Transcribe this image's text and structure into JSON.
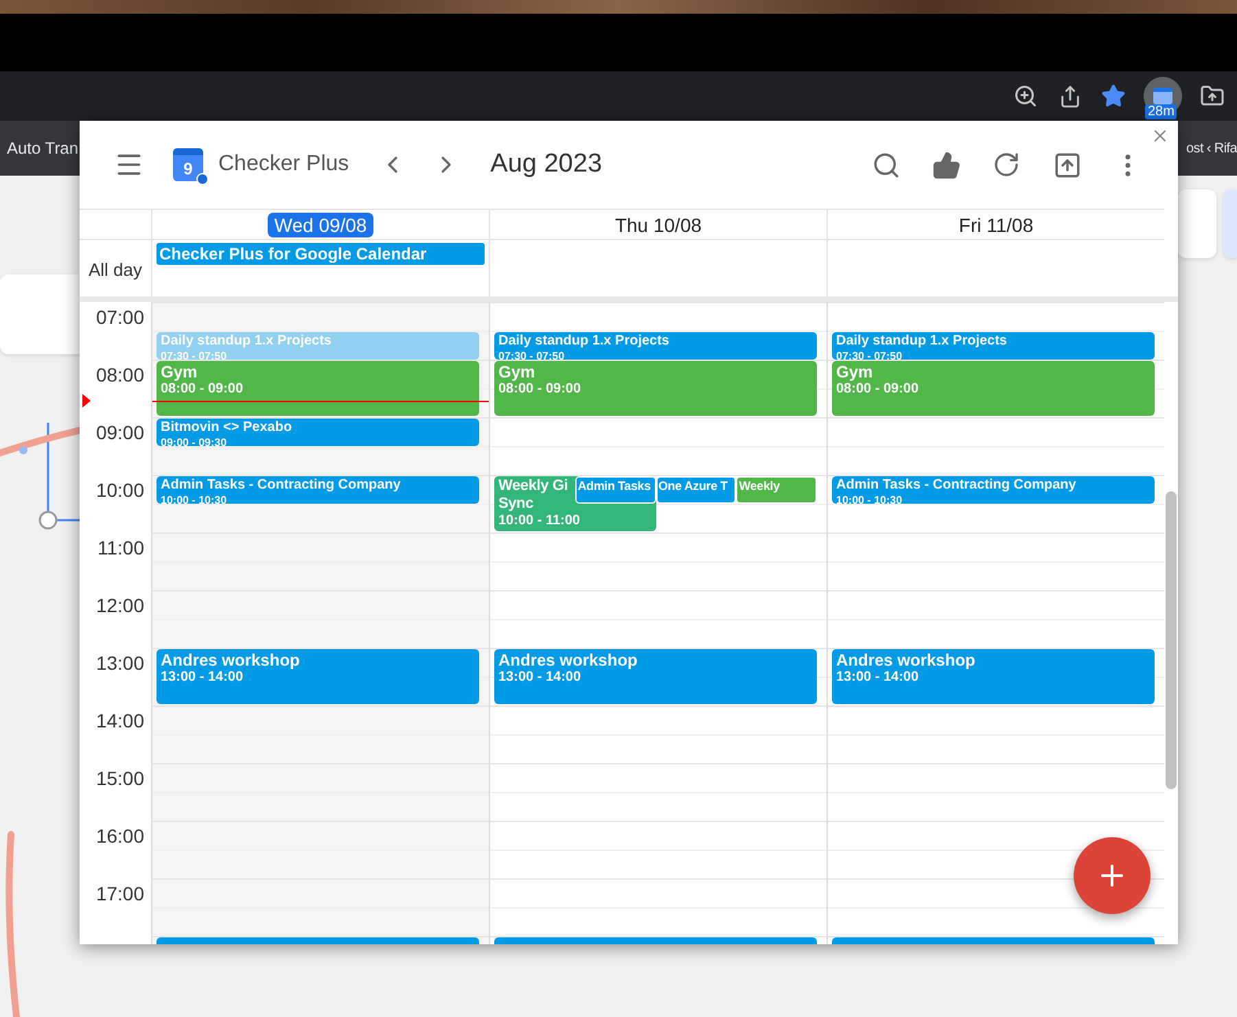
{
  "browser": {
    "extension_badge": "28m",
    "bookmarks": [
      {
        "label": "Auto Tran"
      },
      {
        "label": "ost ‹ Rifa"
      }
    ]
  },
  "popup": {
    "app": {
      "icon_day": "9",
      "name": "Checker Plus"
    },
    "period": "Aug 2023",
    "all_day_label": "All day",
    "hours": [
      "07:00",
      "08:00",
      "09:00",
      "10:00",
      "11:00",
      "12:00",
      "13:00",
      "14:00",
      "15:00",
      "16:00",
      "17:00"
    ],
    "now_marker": {
      "shown": true
    },
    "days": [
      {
        "label": "Wed 09/08",
        "selected": true,
        "all_day": [
          {
            "title": "Checker Plus for Google Calendar",
            "color": "#039be5"
          }
        ],
        "events": [
          {
            "kind": "timed",
            "title": "Daily standup 1.x Projects",
            "time": "07:30 - 07:50",
            "color": "#92d0ef"
          },
          {
            "kind": "timed",
            "title": "Gym",
            "time": "08:00 - 09:00",
            "color": "#51b749"
          },
          {
            "kind": "timed",
            "title": "Bitmovin <> Pexabo",
            "time": "09:00 - 09:30",
            "color": "#039be5"
          },
          {
            "kind": "timed",
            "title": "Admin Tasks - Contracting Company",
            "time": "10:00 - 10:30",
            "color": "#039be5"
          },
          {
            "kind": "timed",
            "title": "Andres workshop",
            "time": "13:00 - 14:00",
            "color": "#039be5"
          },
          {
            "kind": "continued",
            "color": "#039be5"
          }
        ]
      },
      {
        "label": "Thu 10/08",
        "selected": false,
        "events": [
          {
            "kind": "timed",
            "title": "Daily standup 1.x Projects",
            "time": "07:30 - 07:50",
            "color": "#039be5"
          },
          {
            "kind": "timed",
            "title": "Gym",
            "time": "08:00 - 09:00",
            "color": "#51b749"
          },
          {
            "kind": "timed",
            "title": "Weekly Gi\nSync",
            "time": "10:00 - 11:00",
            "color": "#33b679"
          },
          {
            "kind": "overlap",
            "title": "Admin Tasks",
            "color": "#039be5"
          },
          {
            "kind": "overlap",
            "title": "One Azure T",
            "color": "#039be5"
          },
          {
            "kind": "overlap",
            "title": "Weekly",
            "color": "#51b749"
          },
          {
            "kind": "timed",
            "title": "Andres workshop",
            "time": "13:00 - 14:00",
            "color": "#039be5"
          },
          {
            "kind": "continued",
            "color": "#039be5"
          }
        ]
      },
      {
        "label": "Fri 11/08",
        "selected": false,
        "events": [
          {
            "kind": "timed",
            "title": "Daily standup 1.x Projects",
            "time": "07:30 - 07:50",
            "color": "#039be5"
          },
          {
            "kind": "timed",
            "title": "Gym",
            "time": "08:00 - 09:00",
            "color": "#51b749"
          },
          {
            "kind": "timed",
            "title": "Admin Tasks - Contracting Company",
            "time": "10:00 - 10:30",
            "color": "#039be5"
          },
          {
            "kind": "timed",
            "title": "Andres workshop",
            "time": "13:00 - 14:00",
            "color": "#039be5"
          },
          {
            "kind": "continued",
            "color": "#039be5"
          }
        ]
      }
    ]
  }
}
